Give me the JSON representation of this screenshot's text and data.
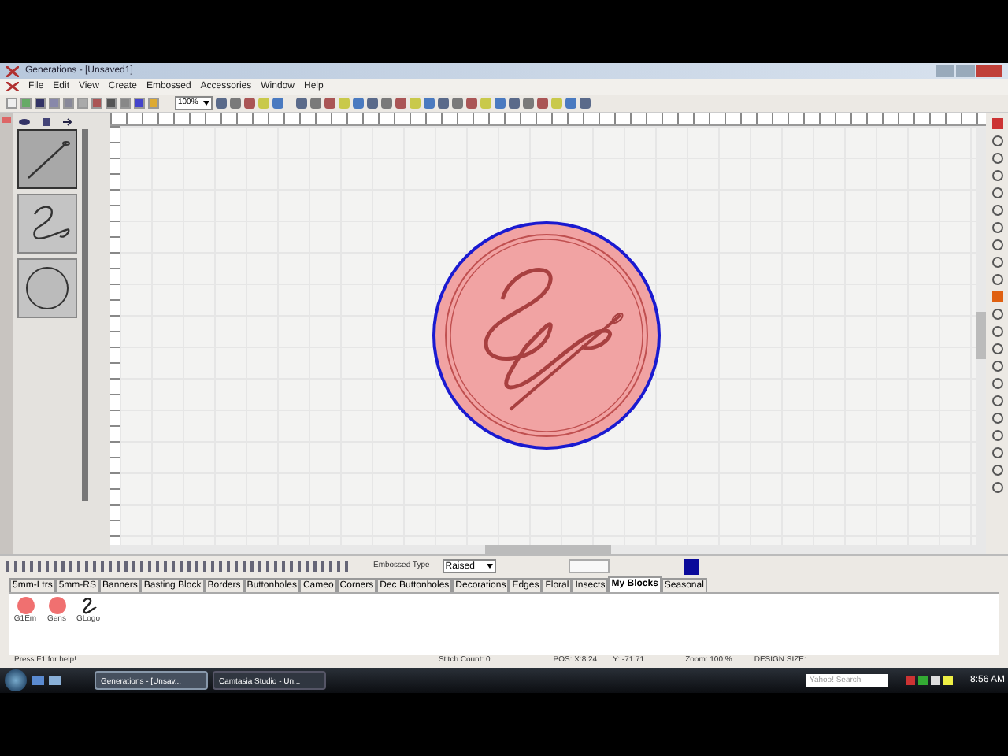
{
  "window": {
    "title": "Generations - [Unsaved1]"
  },
  "menu": [
    "File",
    "Edit",
    "View",
    "Create",
    "Embossed",
    "Accessories",
    "Window",
    "Help"
  ],
  "toolbar": {
    "zoom": "100%"
  },
  "layers": [
    {
      "kind": "needle",
      "selected": true
    },
    {
      "kind": "letter",
      "selected": false
    },
    {
      "kind": "circle",
      "selected": false
    }
  ],
  "embossed": {
    "label": "Embossed Type",
    "value": "Raised",
    "color": "#0a0a9a"
  },
  "tabs": [
    {
      "label": "5mm-Ltrs",
      "selected": false
    },
    {
      "label": "5mm-RS",
      "selected": false
    },
    {
      "label": "Banners",
      "selected": false
    },
    {
      "label": "Basting Block",
      "selected": false
    },
    {
      "label": "Borders",
      "selected": false
    },
    {
      "label": "Buttonholes",
      "selected": false
    },
    {
      "label": "Cameo",
      "selected": false
    },
    {
      "label": "Corners",
      "selected": false
    },
    {
      "label": "Dec Buttonholes",
      "selected": false
    },
    {
      "label": "Decorations",
      "selected": false
    },
    {
      "label": "Edges",
      "selected": false
    },
    {
      "label": "Floral",
      "selected": false
    },
    {
      "label": "Insects",
      "selected": false
    },
    {
      "label": "My Blocks",
      "selected": true
    },
    {
      "label": "Seasonal",
      "selected": false
    }
  ],
  "blocks": [
    {
      "name": "G1Em",
      "kind": "dot"
    },
    {
      "name": "Gens",
      "kind": "dot"
    },
    {
      "name": "GLogo",
      "kind": "logo"
    }
  ],
  "status_bar": [
    "Press F1 for help!",
    "Stitch Count: 0",
    "POS: X:8.24",
    "Y: -71.71",
    "Zoom: 100 %",
    "DESIGN SIZE:"
  ],
  "taskbar": {
    "items": [
      {
        "label": "Generations - [Unsav...",
        "selected": true
      },
      {
        "label": "Camtasia Studio - Un...",
        "selected": false
      }
    ],
    "search": "Yahoo! Search",
    "clock": "8:56 AM"
  }
}
